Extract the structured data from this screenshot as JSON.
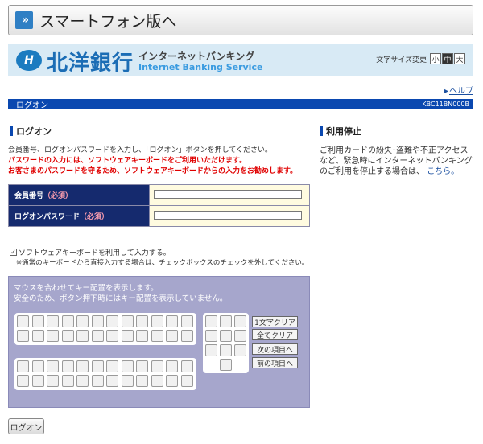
{
  "smartphone_link": {
    "label": "スマートフォン版へ"
  },
  "header": {
    "bank_name": "北洋銀行",
    "service_jp": "インターネットバンキング",
    "service_en": "Internet Banking Service",
    "font_size_label": "文字サイズ変更",
    "font_sizes": [
      "小",
      "中",
      "大"
    ],
    "font_size_selected": "中"
  },
  "help_link": "ヘルプ",
  "title_bar": {
    "title": "ログオン",
    "page_code": "KBC11BN000B"
  },
  "login_section": {
    "title": "ログオン",
    "instruction": "会員番号、ログオンパスワードを入力し、「ログオン」ボタンを押してください。",
    "warning1": "パスワードの入力には、ソフトウェアキーボードをご利用いただけます。",
    "warning2": "お客さまのパスワードを守るため、ソフトウェアキーボードからの入力をお勧めします。"
  },
  "form": {
    "member_label": "会員番号",
    "password_label": "ログオンパスワード",
    "required_mark": "（必須）",
    "member_value": "",
    "password_value": ""
  },
  "suspend_section": {
    "title": "利用停止",
    "text": "ご利用カードの紛失･盗難や不正アクセスなど、緊急時にインターネットバンキングのご利用を停止する場合は、",
    "link": "こちら。"
  },
  "software_keyboard": {
    "checkbox_label": "ソフトウェアキーボードを利用して入力する。",
    "checked": true,
    "note": "※通常のキーボードから直接入力する場合は、チェックボックスのチェックを外してください。",
    "message_line1": "マウスを合わせてキー配置を表示します。",
    "message_line2": "安全のため、ボタン押下時にはキー配置を表示していません。",
    "buttons": [
      "1文字クリア",
      "全てクリア",
      "次の項目へ",
      "前の項目へ"
    ]
  },
  "login_button": "ログオン",
  "colors": {
    "title_bar": "#0a48b0",
    "form_label_bg": "#152a6e",
    "form_field_bg": "#fffbe0",
    "keyboard_bg": "#a6a6cc",
    "warning_text": "#e00000",
    "banner_bg": "#d8eaf5"
  }
}
